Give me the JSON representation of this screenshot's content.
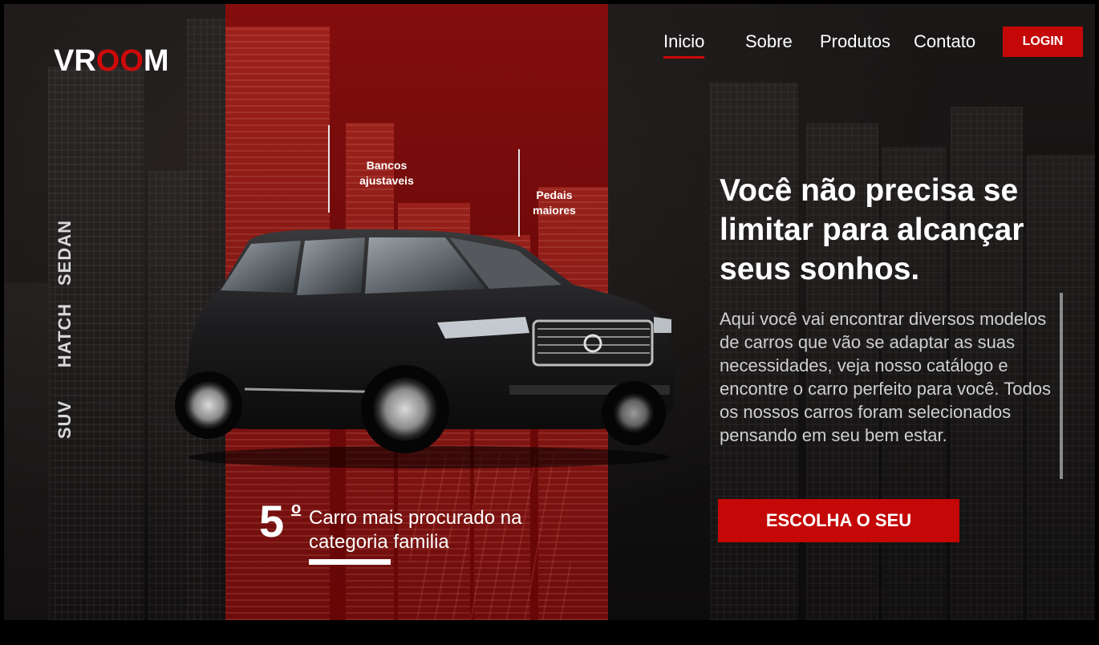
{
  "brand": {
    "prefix": "VR",
    "oo": "OO",
    "suffix": "M",
    "accent_color": "#cc0a0a"
  },
  "nav": {
    "items": [
      {
        "label": "Inicio",
        "active": true
      },
      {
        "label": "Sobre",
        "active": false
      },
      {
        "label": "Produtos",
        "active": false
      },
      {
        "label": "Contato",
        "active": false
      }
    ],
    "login_label": "LOGIN"
  },
  "categories": [
    "SEDAN",
    "HATCH",
    "SUV"
  ],
  "callouts": {
    "seats": "Bancos ajustaveis",
    "pedals": "Pedais maiores"
  },
  "ranking": {
    "number": "5",
    "ordinal": "o",
    "text": "Carro mais procurado na categoria familia"
  },
  "hero": {
    "headline": "Você não precisa se limitar para alcançar seus sonhos.",
    "description": "Aqui você vai encontrar diversos modelos de carros que vão se adaptar as suas necessidades, veja nosso catálogo e encontre o  carro perfeito para você. Todos os nossos carros foram selecionados pensando em seu bem estar.",
    "cta_label": "ESCOLHA O SEU"
  },
  "icons": {
    "car_image": "suv-car-image"
  }
}
